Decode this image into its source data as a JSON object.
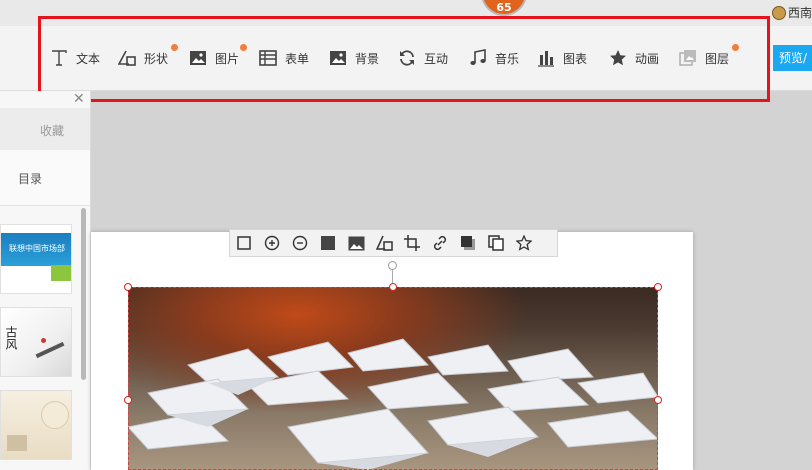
{
  "header": {
    "badge_count": "65",
    "user_label": "西南"
  },
  "toolbar": {
    "items": [
      {
        "label": "文本",
        "icon": "text-icon",
        "dot": false
      },
      {
        "label": "形状",
        "icon": "shape-icon",
        "dot": true
      },
      {
        "label": "图片",
        "icon": "image-icon",
        "dot": true
      },
      {
        "label": "表单",
        "icon": "form-icon",
        "dot": false
      },
      {
        "label": "背景",
        "icon": "background-icon",
        "dot": false
      },
      {
        "label": "互动",
        "icon": "interaction-icon",
        "dot": false
      },
      {
        "label": "音乐",
        "icon": "music-icon",
        "dot": false
      },
      {
        "label": "图表",
        "icon": "chart-icon",
        "dot": false
      },
      {
        "label": "动画",
        "icon": "star-icon",
        "dot": false
      },
      {
        "label": "图层",
        "icon": "layers-icon",
        "dot": true
      }
    ],
    "preview_label": "预览/",
    "accent_color": "#1aa8f0",
    "dot_color": "#f47c3c",
    "highlight_color": "#e3141c"
  },
  "sidebar": {
    "tab_favorites": "收藏",
    "tab_toc": "目录",
    "thumbs": [
      {
        "title": "联想中国市场部"
      },
      {
        "title": "古风"
      },
      {
        "title": ""
      }
    ]
  },
  "image_toolbar": {
    "buttons": [
      "border-icon",
      "zoom-in-icon",
      "zoom-out-icon",
      "fill-icon",
      "replace-image-icon",
      "shape-mask-icon",
      "crop-icon",
      "link-icon",
      "shadow-icon",
      "copy-icon",
      "favorite-icon"
    ]
  }
}
